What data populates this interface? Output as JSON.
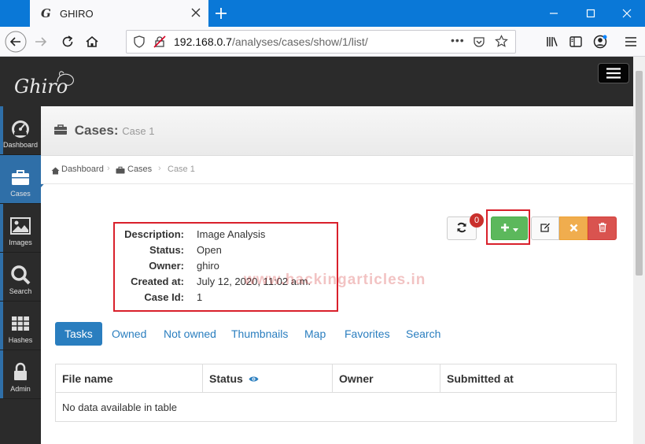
{
  "browser": {
    "tab_title": "GHIRO",
    "tab_favicon": "G",
    "url_host": "192.168.0.7",
    "url_path": "/analyses/cases/show/1/list/",
    "url_more": "•••"
  },
  "app": {
    "logo_text": "Ghiro"
  },
  "sidebar": {
    "items": [
      {
        "label": "Dashboard",
        "icon": "dashboard-icon"
      },
      {
        "label": "Cases",
        "icon": "briefcase-icon"
      },
      {
        "label": "Images",
        "icon": "image-icon"
      },
      {
        "label": "Search",
        "icon": "search-icon"
      },
      {
        "label": "Hashes",
        "icon": "table-icon"
      },
      {
        "label": "Admin",
        "icon": "lock-icon"
      }
    ]
  },
  "page": {
    "title": "Cases:",
    "subtitle": "Case 1"
  },
  "breadcrumb": {
    "items": [
      "Dashboard",
      "Cases",
      "Case 1"
    ],
    "separator": "›"
  },
  "case": {
    "fields": [
      {
        "label": "Description:",
        "value": "Image Analysis"
      },
      {
        "label": "Status:",
        "value": "Open"
      },
      {
        "label": "Owner:",
        "value": "ghiro"
      },
      {
        "label": "Created at:",
        "value": "July 12, 2020, 11:02 a.m."
      },
      {
        "label": "Case Id:",
        "value": "1"
      }
    ]
  },
  "watermark": "www.hackingarticles.in",
  "actions": {
    "refresh_badge": "0"
  },
  "tabs": [
    "Tasks",
    "Owned",
    "Not owned",
    "Thumbnails",
    "Map",
    "Favorites",
    "Search"
  ],
  "table": {
    "columns": [
      "File name",
      "Status",
      "Owner",
      "Submitted at"
    ],
    "empty_message": "No data available in table"
  },
  "colors": {
    "accent": "#2a7ebf",
    "highlight": "#d9202b",
    "success": "#5cb85c",
    "warning": "#f0ad4e",
    "danger": "#d9534f"
  }
}
